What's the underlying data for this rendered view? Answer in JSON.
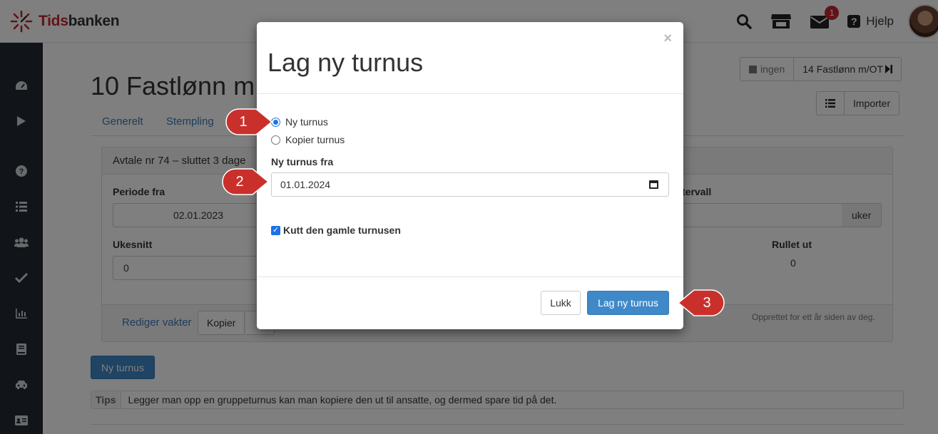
{
  "app": {
    "logo_text_1": "Tids",
    "logo_text_2": "banken"
  },
  "topbar": {
    "mail_count": "1",
    "help_label": "Hjelp"
  },
  "page": {
    "title": "10 Fastlønn m",
    "btn_ingen": "ingen",
    "btn_profile": "14 Fastlønn m/OT",
    "btn_import": "Importer",
    "tabs": [
      "Generelt",
      "Stempling"
    ]
  },
  "panel": {
    "heading": "Avtale nr 74 – sluttet 3 dage",
    "periode_fra_label": "Periode fra",
    "periode_fra_value": "02.01.2023",
    "intervall_label": "tervall",
    "intervall_unit": "uker",
    "ukesnitt_label": "Ukesnitt",
    "ukesnitt_value": "0",
    "rullet_ut_label": "Rullet ut",
    "rullet_ut_value": "0",
    "rediger_vakter": "Rediger vakter",
    "kopier": "Kopier",
    "created_note": "Opprettet for ett år siden av deg."
  },
  "ny_turnus_button": "Ny turnus",
  "tips": {
    "label": "Tips",
    "text": "Legger man opp en gruppeturnus kan man kopiere den ut til ansatte, og dermed spare tid på det."
  },
  "modal": {
    "close": "×",
    "title": "Lag ny turnus",
    "radio_new": "Ny turnus",
    "radio_copy": "Kopier turnus",
    "from_label": "Ny turnus fra",
    "from_value": "01.01.2024",
    "cut_label": "Kutt den gamle turnusen",
    "close_button": "Lukk",
    "submit_button": "Lag ny turnus"
  },
  "callouts": [
    "1",
    "2",
    "3"
  ],
  "colors": {
    "brand_red": "#c4262e",
    "primary_blue": "#3f89c9",
    "sidebar": "#222931",
    "callout_red": "#c9302c"
  }
}
